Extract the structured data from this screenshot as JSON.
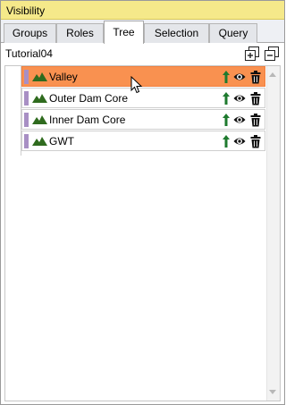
{
  "panel": {
    "title": "Visibility"
  },
  "tabs": [
    {
      "label": "Groups",
      "active": false
    },
    {
      "label": "Roles",
      "active": false
    },
    {
      "label": "Tree",
      "active": true
    },
    {
      "label": "Selection",
      "active": false
    },
    {
      "label": "Query",
      "active": false
    }
  ],
  "toolbar": {
    "title": "Tutorial04",
    "expand_icon": "expand-all-icon",
    "collapse_icon": "collapse-all-icon"
  },
  "tree": {
    "items": [
      {
        "label": "Valley",
        "selected": true,
        "swatch_color": "#a88fc4",
        "icon": "mountain-icon"
      },
      {
        "label": "Outer Dam Core",
        "selected": false,
        "swatch_color": "#a88fc4",
        "icon": "mountain-icon"
      },
      {
        "label": "Inner Dam Core",
        "selected": false,
        "swatch_color": "#a88fc4",
        "icon": "mountain-icon"
      },
      {
        "label": "GWT",
        "selected": false,
        "swatch_color": "#a88fc4",
        "icon": "mountain-icon"
      }
    ],
    "row_icons": [
      "move-up-arrow-icon",
      "eye-icon",
      "trash-icon"
    ]
  },
  "colors": {
    "title_bar": "#f5e98a",
    "selection": "#f99150",
    "mountain": "#2f6b1e",
    "arrow": "#1e7a2e"
  }
}
